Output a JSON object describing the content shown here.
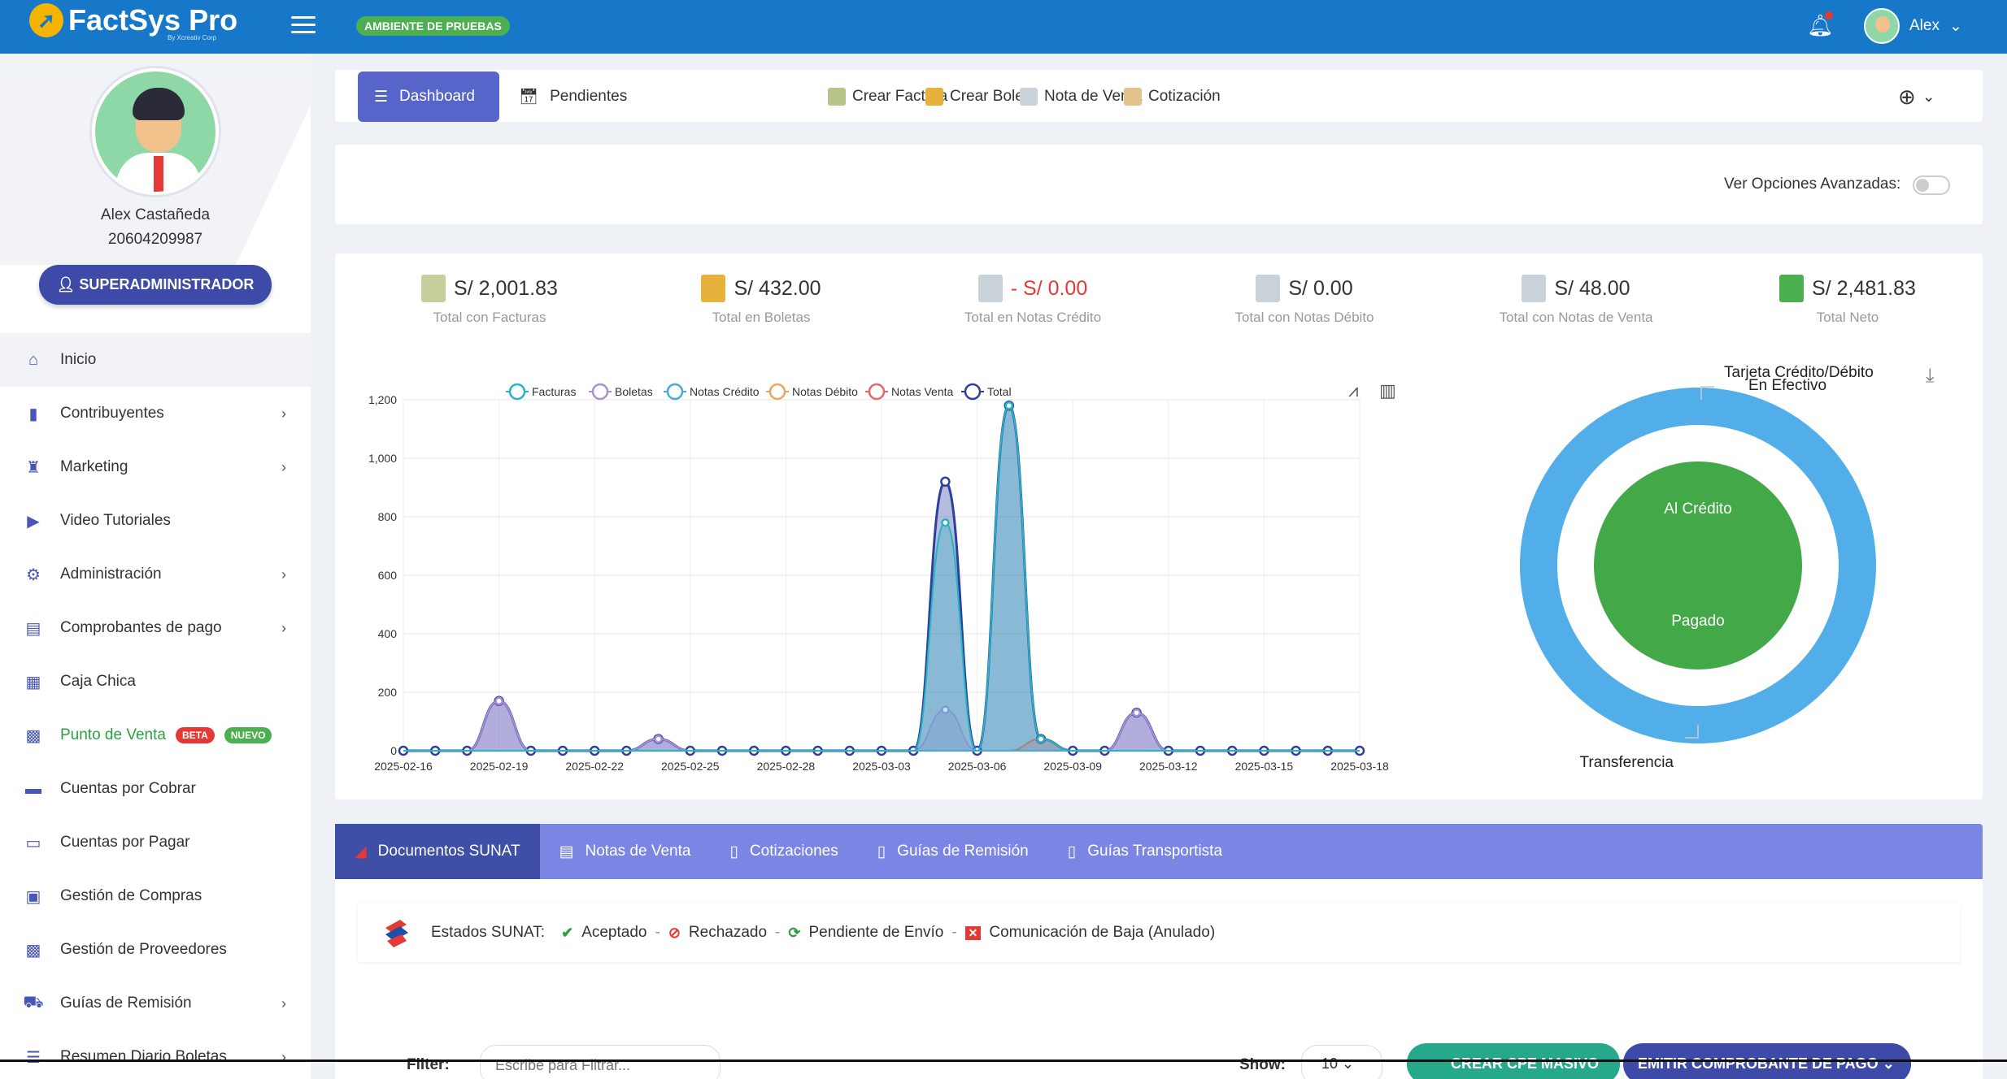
{
  "topbar": {
    "logo_text": "FactSys Pro",
    "logo_tagline": "By Xcreativ Corp",
    "env_badge": "AMBIENTE DE PRUEBAS",
    "user_name": "Alex",
    "accent": "#1778c9"
  },
  "sidebar": {
    "profile": {
      "name": "Alex Castañeda",
      "ruc": "20604209987",
      "role_label": "SUPERADMINISTRADOR"
    },
    "items": [
      {
        "label": "Inicio",
        "icon": "home-icon",
        "active": true
      },
      {
        "label": "Contribuyentes",
        "icon": "building-icon",
        "chevron": true
      },
      {
        "label": "Marketing",
        "icon": "trophy-icon",
        "chevron": true
      },
      {
        "label": "Video Tutoriales",
        "icon": "video-icon"
      },
      {
        "label": "Administración",
        "icon": "gear-icon",
        "chevron": true
      },
      {
        "label": "Comprobantes de pago",
        "icon": "document-icon",
        "chevron": true
      },
      {
        "label": "Caja Chica",
        "icon": "calculator-icon"
      },
      {
        "label": "Punto de Venta",
        "icon": "store-icon",
        "badges": [
          "BETA",
          "NUEVO"
        ]
      },
      {
        "label": "Cuentas por Cobrar",
        "icon": "money-icon"
      },
      {
        "label": "Cuentas por Pagar",
        "icon": "card-icon"
      },
      {
        "label": "Gestión de Compras",
        "icon": "bag-icon"
      },
      {
        "label": "Gestión de Proveedores",
        "icon": "warehouse-icon"
      },
      {
        "label": "Guías de Remisión",
        "icon": "truck-icon",
        "chevron": true
      },
      {
        "label": "Resumen Diario Boletas",
        "icon": "list-icon",
        "chevron": true
      }
    ]
  },
  "tabs": {
    "dashboard_label": "Dashboard",
    "pending_label": "Pendientes",
    "quick_actions": [
      "Crear Factura",
      "Crear Boleta",
      "Nota de Venta",
      "Cotización"
    ]
  },
  "advanced": {
    "label": "Ver Opciones Avanzadas:",
    "enabled": false
  },
  "stats": [
    {
      "value": "S/ 2,001.83",
      "label": "Total con Facturas",
      "negative": false
    },
    {
      "value": "S/ 432.00",
      "label": "Total en Boletas",
      "negative": false
    },
    {
      "value": "- S/ 0.00",
      "label": "Total en Notas Crédito",
      "negative": true
    },
    {
      "value": "S/ 0.00",
      "label": "Total con Notas Débito",
      "negative": false
    },
    {
      "value": "S/ 48.00",
      "label": "Total con Notas de Venta",
      "negative": false
    },
    {
      "value": "S/ 2,481.83",
      "label": "Total Neto",
      "negative": false
    }
  ],
  "chart_data": [
    {
      "type": "area",
      "legend_position": "top",
      "grid": true,
      "ylim": [
        0,
        1200
      ],
      "yticks": [
        "0",
        "200",
        "400",
        "600",
        "800",
        "1,000",
        "1,200"
      ],
      "xticks": [
        "2025-02-16",
        "2025-02-19",
        "2025-02-22",
        "2025-02-25",
        "2025-02-28",
        "2025-03-03",
        "2025-03-06",
        "2025-03-09",
        "2025-03-12",
        "2025-03-15",
        "2025-03-18"
      ],
      "x": [
        "2025-02-16",
        "2025-02-17",
        "2025-02-18",
        "2025-02-19",
        "2025-02-20",
        "2025-02-21",
        "2025-02-22",
        "2025-02-23",
        "2025-02-24",
        "2025-02-25",
        "2025-02-26",
        "2025-02-27",
        "2025-02-28",
        "2025-03-01",
        "2025-03-02",
        "2025-03-03",
        "2025-03-04",
        "2025-03-05",
        "2025-03-06",
        "2025-03-07",
        "2025-03-08",
        "2025-03-09",
        "2025-03-10",
        "2025-03-11",
        "2025-03-12",
        "2025-03-13",
        "2025-03-14",
        "2025-03-15",
        "2025-03-16",
        "2025-03-17",
        "2025-03-18"
      ],
      "series": [
        {
          "name": "Facturas",
          "color": "#26b3c4",
          "values": [
            0,
            0,
            0,
            0,
            0,
            0,
            0,
            0,
            0,
            0,
            0,
            0,
            0,
            0,
            0,
            0,
            0,
            780,
            0,
            1180,
            40,
            0,
            0,
            0,
            0,
            0,
            0,
            0,
            0,
            0,
            0
          ]
        },
        {
          "name": "Boletas",
          "color": "#a88fd6",
          "values": [
            0,
            0,
            0,
            170,
            0,
            0,
            0,
            0,
            40,
            0,
            0,
            0,
            0,
            0,
            0,
            0,
            0,
            140,
            0,
            0,
            0,
            0,
            0,
            130,
            0,
            0,
            0,
            0,
            0,
            0,
            0
          ]
        },
        {
          "name": "Notas Crédito",
          "color": "#4aa9d9",
          "values": [
            0,
            0,
            0,
            0,
            0,
            0,
            0,
            0,
            0,
            0,
            0,
            0,
            0,
            0,
            0,
            0,
            0,
            0,
            0,
            0,
            0,
            0,
            0,
            0,
            0,
            0,
            0,
            0,
            0,
            0,
            0
          ]
        },
        {
          "name": "Notas Débito",
          "color": "#f0a35c",
          "values": [
            0,
            0,
            0,
            0,
            0,
            0,
            0,
            0,
            0,
            0,
            0,
            0,
            0,
            0,
            0,
            0,
            0,
            0,
            0,
            0,
            0,
            0,
            0,
            0,
            0,
            0,
            0,
            0,
            0,
            0,
            0
          ]
        },
        {
          "name": "Notas Venta",
          "color": "#e0696b",
          "values": [
            0,
            0,
            0,
            0,
            0,
            0,
            0,
            0,
            0,
            0,
            0,
            0,
            0,
            0,
            0,
            0,
            0,
            0,
            0,
            0,
            40,
            0,
            0,
            0,
            0,
            0,
            0,
            0,
            0,
            0,
            0
          ]
        },
        {
          "name": "Total",
          "color": "#2f3f9e",
          "values": [
            0,
            0,
            0,
            170,
            0,
            0,
            0,
            0,
            40,
            0,
            0,
            0,
            0,
            0,
            0,
            0,
            0,
            920,
            0,
            1180,
            40,
            0,
            0,
            130,
            0,
            0,
            0,
            0,
            0,
            0,
            0
          ]
        }
      ]
    },
    {
      "type": "pie",
      "labels": [
        "Tarjeta Crédito/Débito",
        "En Efectivo",
        "Al Crédito",
        "Pagado",
        "Transferencia"
      ],
      "rings": [
        {
          "name": "outer",
          "color": "#52aee8",
          "slices": [
            {
              "label": "Transferencia",
              "value": 100
            },
            {
              "label": "Tarjeta Crédito/Débito",
              "value": 0
            },
            {
              "label": "En Efectivo",
              "value": 0
            }
          ]
        },
        {
          "name": "inner",
          "color": "#43a847",
          "slices": [
            {
              "label": "Al Crédito",
              "value": 50
            },
            {
              "label": "Pagado",
              "value": 50
            }
          ]
        }
      ]
    }
  ],
  "docs_tabs": [
    "Documentos SUNAT",
    "Notas de Venta",
    "Cotizaciones",
    "Guías de Remisión",
    "Guías Transportista"
  ],
  "sunat_states": {
    "title": "Estados SUNAT:",
    "items": [
      {
        "label": "Aceptado",
        "icon": "check-icon",
        "color": "#2e9e44"
      },
      {
        "label": "Rechazado",
        "icon": "forbidden-icon",
        "color": "#e53935"
      },
      {
        "label": "Pendiente de Envío",
        "icon": "sync-icon",
        "color": "#2e9e44"
      },
      {
        "label": "Comunicación de Baja (Anulado)",
        "icon": "cross-box-icon",
        "color": "#e53935"
      }
    ]
  },
  "bottom": {
    "filter_label": "Filter:",
    "filter_placeholder": "Escribe para Filtrar...",
    "show_label": "Show:",
    "show_value": "10",
    "bulk_button": "CREAR CPE MASIVO",
    "emit_button": "EMITIR COMPROBANTE DE PAGO"
  }
}
